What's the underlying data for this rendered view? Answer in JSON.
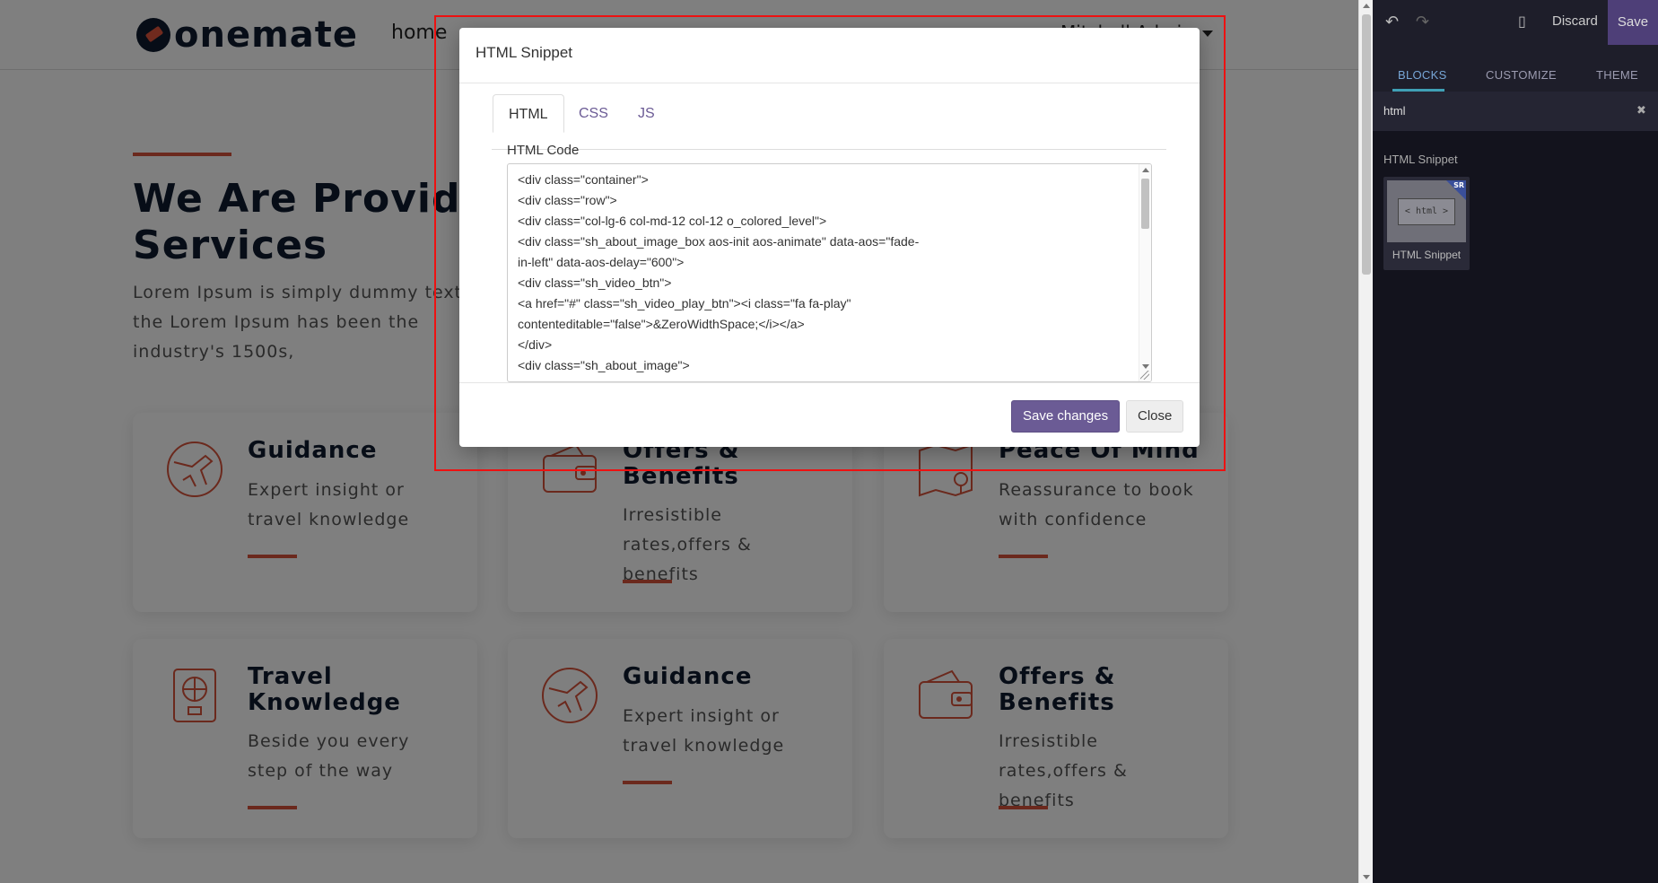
{
  "website": {
    "logo_text": "onemate",
    "nav": {
      "home": "home",
      "more": "Mitchell Admin"
    },
    "hero": {
      "title": "We Are Providing Services",
      "text": "Lorem Ipsum is simply dummy text the Lorem Ipsum has been the industry's 1500s,"
    },
    "cards": [
      {
        "title": "Guidance",
        "text": "Expert insight or travel knowledge",
        "icon": "globe-plane-icon"
      },
      {
        "title": "Offers & Benefits",
        "text": "Irresistible rates,offers & benefits",
        "icon": "wallet-icon"
      },
      {
        "title": "Peace Of Mind",
        "text": "Reassurance to book with confidence",
        "icon": "map-pin-icon"
      },
      {
        "title": "Travel Knowledge",
        "text": "Beside you every step of the way",
        "icon": "passport-icon"
      },
      {
        "title": "Guidance",
        "text": "Expert insight or travel knowledge",
        "icon": "globe-plane-icon"
      },
      {
        "title": "Offers & Benefits",
        "text": "Irresistible rates,offers & benefits",
        "icon": "wallet-icon"
      }
    ],
    "accent_color": "#d6533b"
  },
  "modal": {
    "title": "HTML Snippet",
    "tabs": [
      "HTML",
      "CSS",
      "JS"
    ],
    "active_tab": "HTML",
    "code_label": "HTML Code",
    "code_lines": [
      "<div class=\"container\">",
      "                        <div class=\"row\">",
      "                              <div class=\"col-lg-6 col-md-12 col-12 o_colored_level\">",
      "                                    <div class=\"sh_about_image_box aos-init aos-animate\" data-aos=\"fade-",
      "in-left\" data-aos-delay=\"600\">",
      "                                          <div class=\"sh_video_btn\">",
      "                                                <a href=\"#\" class=\"sh_video_play_btn\"><i class=\"fa fa-play\"",
      "contenteditable=\"false\">&ZeroWidthSpace;</i></a>",
      "                                          </div>",
      "                                          <div class=\"sh_about_image\">"
    ],
    "save_label": "Save changes",
    "close_label": "Close",
    "primary_color": "#6b5b95"
  },
  "editor_panel": {
    "discard_label": "Discard",
    "save_label": "Save",
    "tabs": [
      "BLOCKS",
      "CUSTOMIZE",
      "THEME"
    ],
    "active_tab": "BLOCKS",
    "search_value": "html",
    "section_title": "HTML Snippet",
    "snippet_label": "HTML Snippet",
    "snippet_thumb_text": "< html >",
    "snippet_badge": "SR",
    "undo_icon": "undo-icon",
    "redo_icon": "redo-icon",
    "mobile_icon": "mobile-preview-icon"
  }
}
